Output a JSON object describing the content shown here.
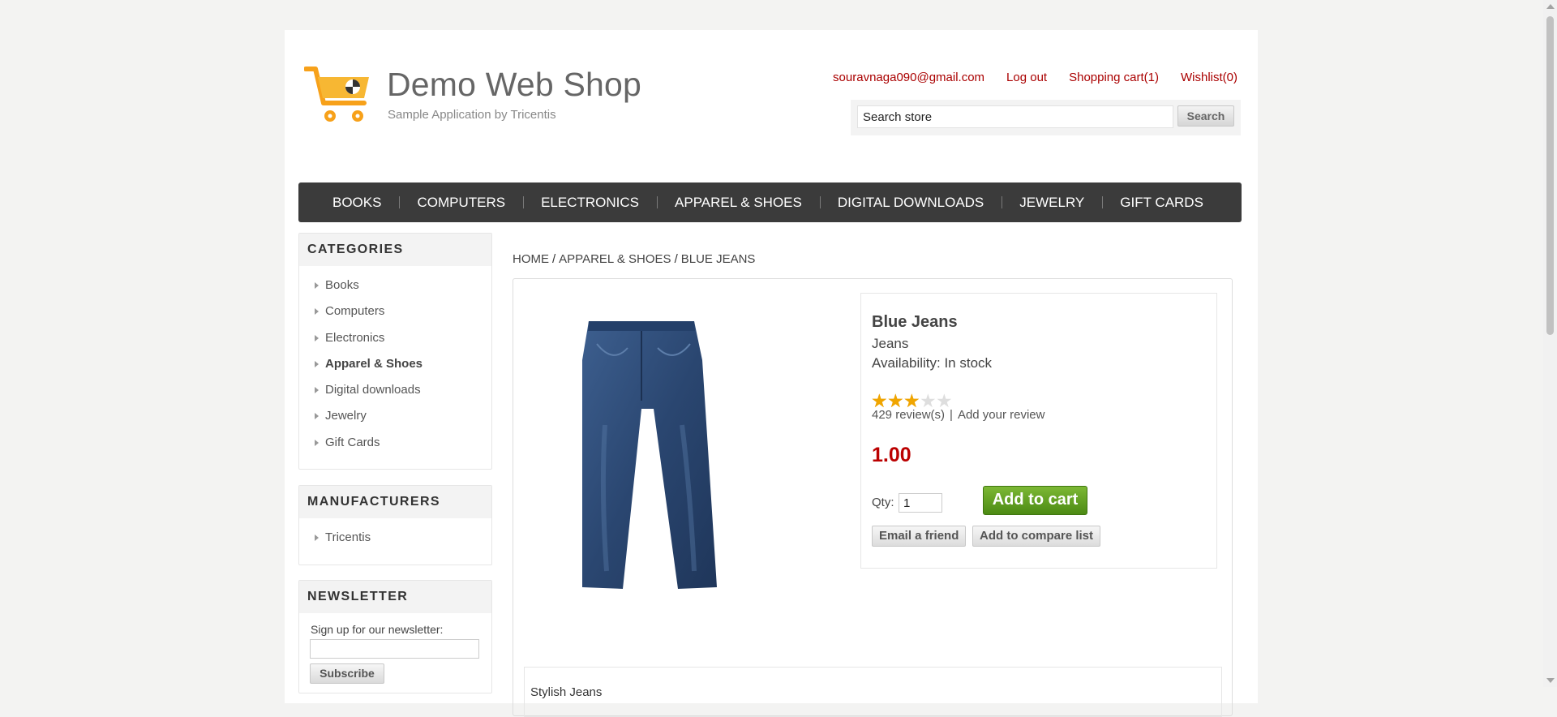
{
  "header": {
    "logo_title": "Demo Web Shop",
    "logo_subtitle": "Sample Application by Tricentis",
    "links": {
      "account": "souravnaga090@gmail.com",
      "logout": "Log out",
      "cart": "Shopping cart(1)",
      "wishlist": "Wishlist(0)"
    },
    "search": {
      "value": "Search store",
      "button": "Search"
    }
  },
  "top_menu": [
    "BOOKS",
    "COMPUTERS",
    "ELECTRONICS",
    "APPAREL & SHOES",
    "DIGITAL DOWNLOADS",
    "JEWELRY",
    "GIFT CARDS"
  ],
  "sidebar": {
    "categories": {
      "title": "CATEGORIES",
      "items": [
        "Books",
        "Computers",
        "Electronics",
        "Apparel & Shoes",
        "Digital downloads",
        "Jewelry",
        "Gift Cards"
      ],
      "active": "Apparel & Shoes"
    },
    "manufacturers": {
      "title": "MANUFACTURERS",
      "items": [
        "Tricentis"
      ]
    },
    "newsletter": {
      "title": "NEWSLETTER",
      "label": "Sign up for our newsletter:",
      "button": "Subscribe"
    }
  },
  "breadcrumb": {
    "home": "HOME",
    "category": "APPAREL & SHOES",
    "current": "BLUE JEANS",
    "separator": "/"
  },
  "product": {
    "name": "Blue Jeans",
    "short_description": "Jeans",
    "availability": "Availability: In stock",
    "rating": 3,
    "rating_max": 5,
    "reviews": "429 review(s)",
    "review_separator": "|",
    "add_review": "Add your review",
    "price": "1.00",
    "qty_label": "Qty:",
    "qty_value": "1",
    "add_to_cart": "Add to cart",
    "email_friend": "Email a friend",
    "compare": "Add to compare list",
    "full_description": "Stylish Jeans"
  },
  "colors": {
    "link_red": "#aa0000",
    "menu_bg": "#3b3b3b",
    "price_red": "#bb0000",
    "cart_green": "#5f9e20",
    "star": "#f0a500"
  }
}
